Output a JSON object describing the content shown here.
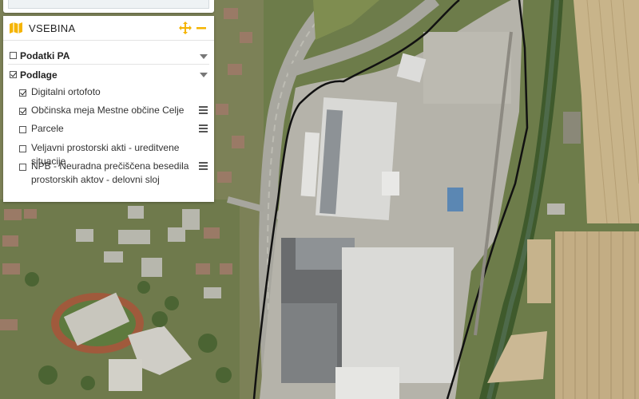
{
  "panel": {
    "title": "VSEBINA",
    "accent_color": "#f5b400",
    "header_icons": [
      "map-icon",
      "move-icon",
      "minimize-icon"
    ],
    "categories": [
      {
        "label": "Podatki PA",
        "checked": false,
        "expanded": false
      },
      {
        "label": "Podlage",
        "checked": true,
        "expanded": true
      }
    ],
    "layers": [
      {
        "label": "Digitalni ortofoto",
        "checked": true,
        "has_menu": false
      },
      {
        "label": "Občinska meja Mestne občine Celje",
        "checked": true,
        "has_menu": true
      },
      {
        "label": "Parcele",
        "checked": false,
        "has_menu": true
      },
      {
        "label": "Veljavni prostorski akti - ureditvene situacije",
        "checked": false,
        "has_menu": false
      },
      {
        "label_line1": "NPB - Neuradna prečiščena besedila",
        "label_line2": "prostorskih aktov - delovni sloj",
        "checked": false,
        "has_menu": true
      }
    ]
  }
}
